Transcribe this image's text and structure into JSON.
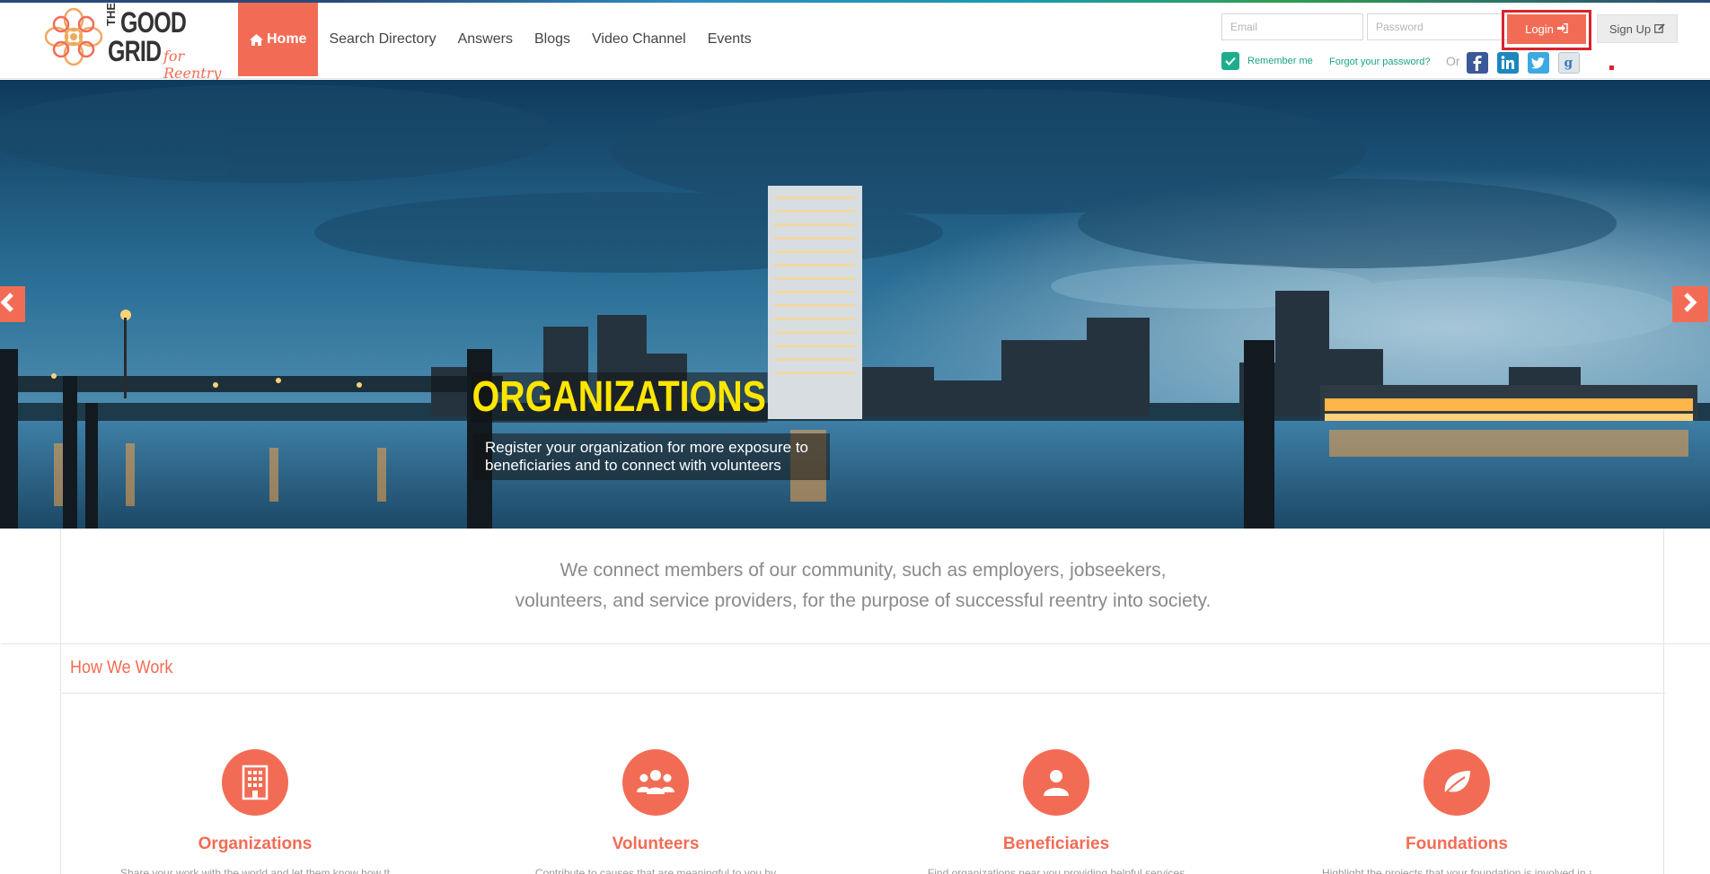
{
  "colors": {
    "accent": "#f26c55",
    "teal": "#1aa38a",
    "highlight": "#d8242c",
    "caption_yellow": "#ffe600"
  },
  "header": {
    "logo": {
      "line1": "THE",
      "line2": "GOOD",
      "line3": "GRID",
      "tagline": "for Reentry",
      "icon": "flower-logo-icon"
    },
    "nav": [
      {
        "label": "Home",
        "icon": "home-icon",
        "active": true
      },
      {
        "label": "Search Directory"
      },
      {
        "label": "Answers"
      },
      {
        "label": "Blogs"
      },
      {
        "label": "Video Channel"
      },
      {
        "label": "Events"
      }
    ],
    "login": {
      "email_placeholder": "Email",
      "password_placeholder": "Password",
      "login_label": "Login",
      "signup_label": "Sign Up",
      "remember_label": "Remember me",
      "remember_checked": true,
      "forgot_label": "Forgot your password?",
      "or_label": "Or",
      "social": [
        "facebook-icon",
        "linkedin-icon",
        "twitter-icon",
        "google-icon"
      ]
    }
  },
  "hero": {
    "title": "ORGANIZATIONS",
    "text_line1": "Register your organization for more exposure to",
    "text_line2": "beneficiaries and to connect with volunteers",
    "prev_icon": "chevron-left-icon",
    "next_icon": "chevron-right-icon"
  },
  "intro": {
    "line1": "We connect members of our community, such as employers, jobseekers,",
    "line2": "volunteers, and service providers, for the purpose of successful reentry into society."
  },
  "how_we_work": {
    "title": "How We Work",
    "cards": [
      {
        "title": "Organizations",
        "icon": "building-icon",
        "desc": "Share your work with the world and let them know how they"
      },
      {
        "title": "Volunteers",
        "icon": "group-icon",
        "desc": "Contribute to causes that are meaningful to you by"
      },
      {
        "title": "Beneficiaries",
        "icon": "user-icon",
        "desc": "Find organizations near you providing helpful services"
      },
      {
        "title": "Foundations",
        "icon": "leaf-icon",
        "desc": "Highlight the projects that your foundation is involved in and"
      }
    ]
  }
}
